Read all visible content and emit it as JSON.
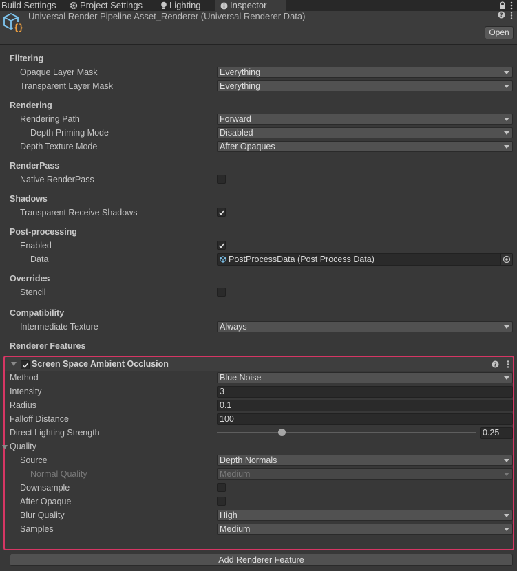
{
  "tabs": [
    {
      "label": "Build Settings",
      "icon": "none"
    },
    {
      "label": "Project Settings",
      "icon": "gear-icon"
    },
    {
      "label": "Lighting",
      "icon": "bulb-icon"
    },
    {
      "label": "Inspector",
      "icon": "info-icon",
      "active": true
    }
  ],
  "header": {
    "title": "Universal Render Pipeline Asset_Renderer (Universal Renderer Data)",
    "open_label": "Open"
  },
  "filtering": {
    "title": "Filtering",
    "opaque_label": "Opaque Layer Mask",
    "opaque_value": "Everything",
    "transparent_label": "Transparent Layer Mask",
    "transparent_value": "Everything"
  },
  "rendering": {
    "title": "Rendering",
    "path_label": "Rendering Path",
    "path_value": "Forward",
    "depth_priming_label": "Depth Priming Mode",
    "depth_priming_value": "Disabled",
    "depth_texture_label": "Depth Texture Mode",
    "depth_texture_value": "After Opaques"
  },
  "renderpass": {
    "title": "RenderPass",
    "native_label": "Native RenderPass",
    "native_checked": false
  },
  "shadows": {
    "title": "Shadows",
    "transparent_receive_label": "Transparent Receive Shadows",
    "transparent_receive_checked": true
  },
  "postprocessing": {
    "title": "Post-processing",
    "enabled_label": "Enabled",
    "enabled_checked": true,
    "data_label": "Data",
    "data_value": "PostProcessData (Post Process Data)"
  },
  "overrides": {
    "title": "Overrides",
    "stencil_label": "Stencil",
    "stencil_checked": false
  },
  "compatibility": {
    "title": "Compatibility",
    "intermediate_label": "Intermediate Texture",
    "intermediate_value": "Always"
  },
  "renderer_features": {
    "title": "Renderer Features"
  },
  "ssao": {
    "title": "Screen Space Ambient Occlusion",
    "enabled": true,
    "method_label": "Method",
    "method_value": "Blue Noise",
    "intensity_label": "Intensity",
    "intensity_value": "3",
    "radius_label": "Radius",
    "radius_value": "0.1",
    "falloff_label": "Falloff Distance",
    "falloff_value": "100",
    "direct_lighting_label": "Direct Lighting Strength",
    "direct_lighting_value": "0.25",
    "direct_lighting_fraction": 0.25,
    "quality_title": "Quality",
    "source_label": "Source",
    "source_value": "Depth Normals",
    "normal_quality_label": "Normal Quality",
    "normal_quality_value": "Medium",
    "downsample_label": "Downsample",
    "downsample_checked": false,
    "after_opaque_label": "After Opaque",
    "after_opaque_checked": false,
    "blur_quality_label": "Blur Quality",
    "blur_quality_value": "High",
    "samples_label": "Samples",
    "samples_value": "Medium"
  },
  "add_feature_label": "Add Renderer Feature",
  "colors": {
    "background": "#383838",
    "highlight_border": "#d63664",
    "field": "#515151"
  }
}
